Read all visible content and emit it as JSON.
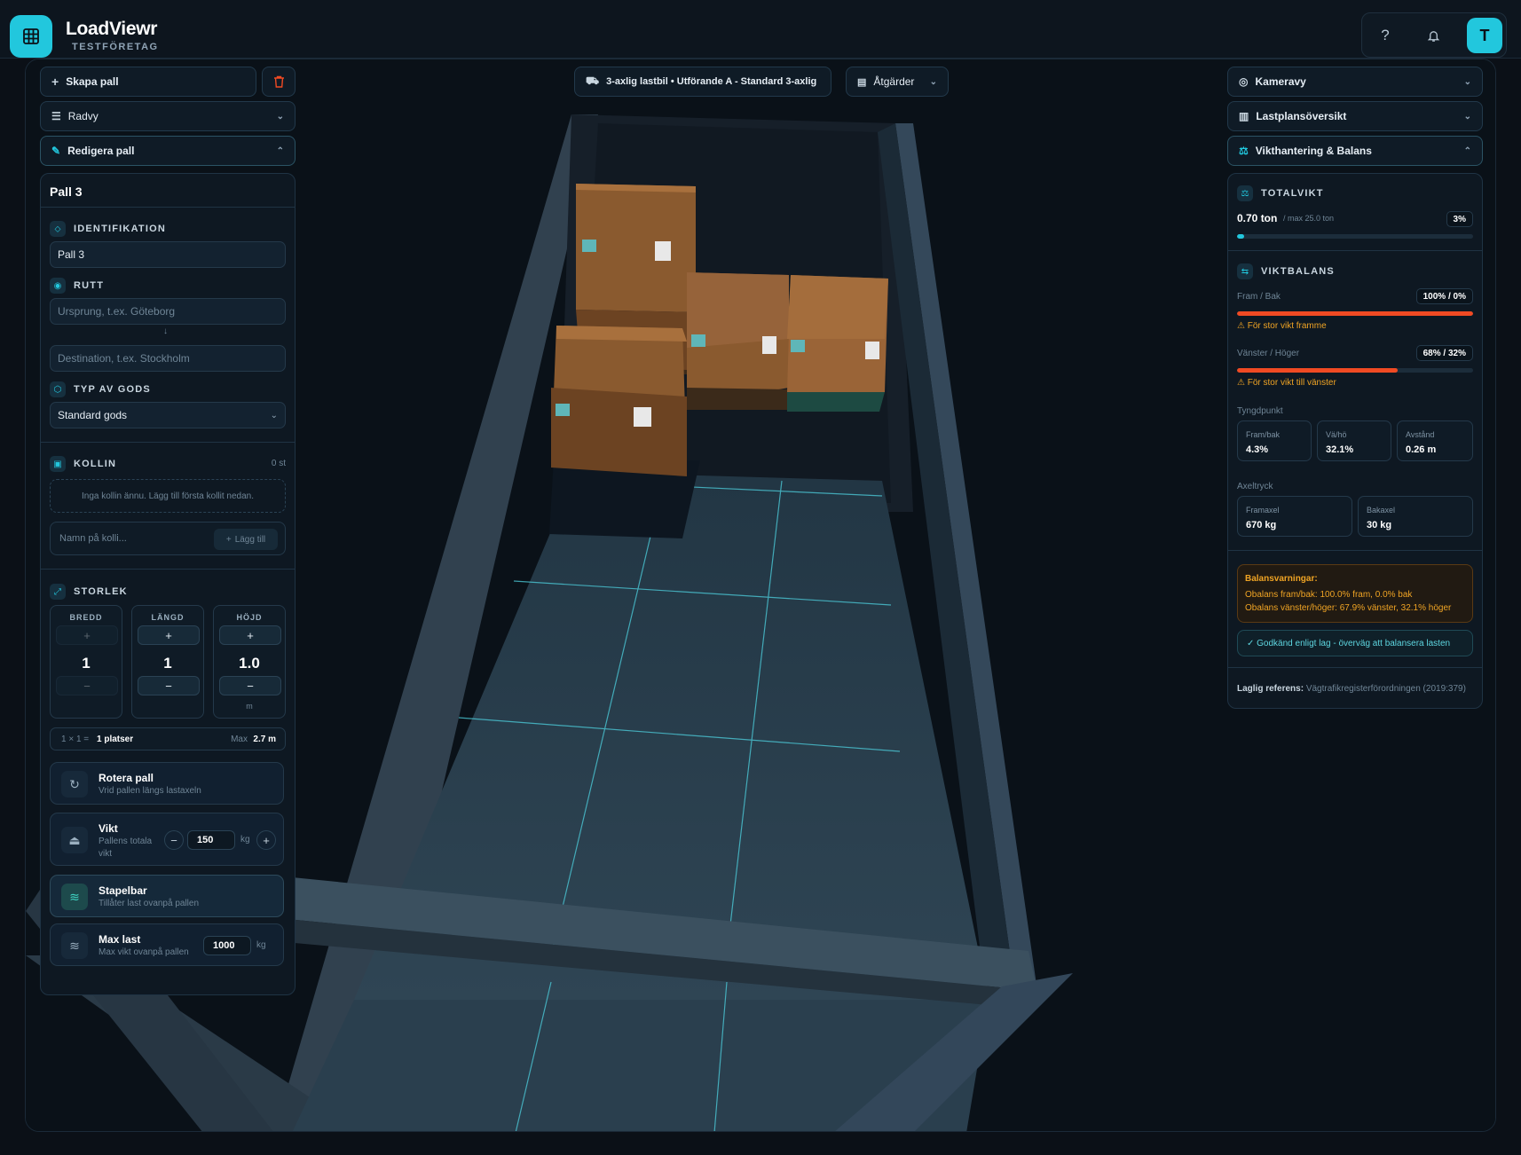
{
  "app": {
    "name": "LoadViewr",
    "company": "TESTFÖRETAG",
    "avatar_initial": "T",
    "accent": "#22c7dd"
  },
  "top_actions": {
    "help_icon": "help-icon",
    "notifications_icon": "bell-icon"
  },
  "toolbar": {
    "create_pallet": "Skapa pall",
    "row_view": "Radvy",
    "edit_pallet": "Redigera pall",
    "vehicle": "3-axlig lastbil • Utförande A - Standard 3-axlig",
    "actions": "Åtgärder",
    "camera_view": "Kameravy",
    "load_plan_overview": "Lastplansöversikt",
    "weight_balance": "Vikthantering & Balans"
  },
  "editor": {
    "title": "Pall 3",
    "identification": {
      "label": "IDENTIFIKATION",
      "value": "Pall 3"
    },
    "route": {
      "label": "RUTT",
      "origin_placeholder": "Ursprung, t.ex. Göteborg",
      "destination_placeholder": "Destination, t.ex. Stockholm",
      "arrow": "↓"
    },
    "cargo_type": {
      "label": "TYP AV GODS",
      "value": "Standard gods"
    },
    "packages": {
      "label": "KOLLIN",
      "count": "0 st",
      "empty_text": "Inga kollin ännu. Lägg till första kollit nedan.",
      "name_placeholder": "Namn på kolli...",
      "add_label": "Lägg till"
    },
    "size": {
      "label": "STORLEK",
      "width": {
        "label": "BREDD",
        "value": "1"
      },
      "length": {
        "label": "LÄNGD",
        "value": "1"
      },
      "height": {
        "label": "HÖJD",
        "value": "1.0",
        "unit": "m"
      },
      "plus": "+",
      "minus": "−",
      "summary_formula": "1 × 1 = ",
      "summary_places": "1 platser",
      "summary_max_label": "Max ",
      "summary_max_value": "2.7 m"
    },
    "rotate": {
      "title": "Rotera pall",
      "subtitle": "Vrid pallen längs lastaxeln"
    },
    "weight": {
      "title": "Vikt",
      "subtitle_line1": "Pallens totala",
      "subtitle_line2": "vikt",
      "value": "150",
      "unit": "kg",
      "minus": "−",
      "plus": "+"
    },
    "stackable": {
      "title": "Stapelbar",
      "subtitle": "Tillåter last ovanpå pallen",
      "enabled": true
    },
    "max_load": {
      "title": "Max last",
      "subtitle": "Max vikt ovanpå pallen",
      "value": "1000",
      "unit": "kg"
    }
  },
  "weight_panel": {
    "total": {
      "label": "TOTALVIKT",
      "value": "0.70 ton",
      "max": "/ max 25.0 ton",
      "percent": "3%",
      "fill_fraction": 0.03
    },
    "balance": {
      "label": "VIKTBALANS",
      "front_back": {
        "label": "Fram / Bak",
        "value": "100% / 0%",
        "fill_fraction": 1.0,
        "warning": "För stor vikt framme"
      },
      "left_right": {
        "label": "Vänster / Höger",
        "value": "68% / 32%",
        "fill_fraction": 0.68,
        "warning": "För stor vikt till vänster"
      }
    },
    "center_of_gravity": {
      "label": "Tyngdpunkt",
      "items": [
        {
          "label": "Fram/bak",
          "value": "4.3%"
        },
        {
          "label": "Vä/hö",
          "value": "32.1%"
        },
        {
          "label": "Avstånd",
          "value": "0.26 m"
        }
      ]
    },
    "axle_load": {
      "label": "Axeltryck",
      "items": [
        {
          "label": "Framaxel",
          "value": "670 kg"
        },
        {
          "label": "Bakaxel",
          "value": "30 kg"
        }
      ]
    },
    "warnings": {
      "title": "Balansvarningar:",
      "lines": [
        "Obalans fram/bak: 100.0% fram, 0.0% bak",
        "Obalans vänster/höger: 67.9% vänster, 32.1% höger"
      ]
    },
    "approved": "✓ Godkänd enligt lag - överväg att balansera lasten",
    "legal_label": "Laglig referens:",
    "legal_text": "Vägtrafikregisterförordningen (2019:379)"
  },
  "colors": {
    "warning": "#f0a424",
    "danger_bar": "#f04a23",
    "panel": "#0e1822"
  }
}
